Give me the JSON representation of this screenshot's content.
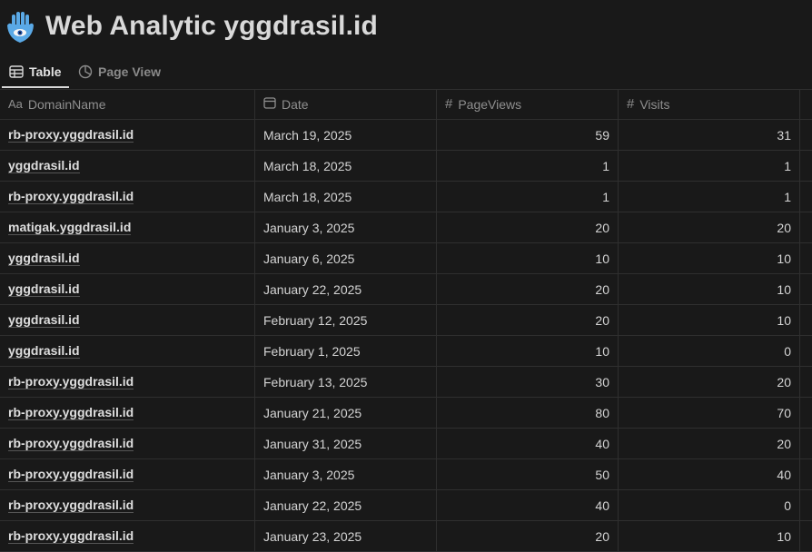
{
  "page": {
    "title": "Web Analytic yggdrasil.id",
    "icon": "hamsa-hand-icon"
  },
  "tabs": [
    {
      "label": "Table",
      "icon": "table-icon",
      "active": true
    },
    {
      "label": "Page View",
      "icon": "pie-chart-icon",
      "active": false
    }
  ],
  "table": {
    "columns": [
      {
        "label": "DomainName",
        "icon_text": "Aa"
      },
      {
        "label": "Date",
        "icon": "calendar-icon"
      },
      {
        "label": "PageViews",
        "icon_text": "#"
      },
      {
        "label": "Visits",
        "icon_text": "#"
      }
    ],
    "rows": [
      {
        "domain": "rb-proxy.yggdrasil.id",
        "date": "March 19, 2025",
        "pageviews": "59",
        "visits": "31"
      },
      {
        "domain": "yggdrasil.id",
        "date": "March 18, 2025",
        "pageviews": "1",
        "visits": "1"
      },
      {
        "domain": "rb-proxy.yggdrasil.id",
        "date": "March 18, 2025",
        "pageviews": "1",
        "visits": "1"
      },
      {
        "domain": "matigak.yggdrasil.id",
        "date": "January 3, 2025",
        "pageviews": "20",
        "visits": "20"
      },
      {
        "domain": "yggdrasil.id",
        "date": "January 6, 2025",
        "pageviews": "10",
        "visits": "10"
      },
      {
        "domain": "yggdrasil.id",
        "date": "January 22, 2025",
        "pageviews": "20",
        "visits": "10"
      },
      {
        "domain": "yggdrasil.id",
        "date": "February 12, 2025",
        "pageviews": "20",
        "visits": "10"
      },
      {
        "domain": "yggdrasil.id",
        "date": "February 1, 2025",
        "pageviews": "10",
        "visits": "0"
      },
      {
        "domain": "rb-proxy.yggdrasil.id",
        "date": "February 13, 2025",
        "pageviews": "30",
        "visits": "20"
      },
      {
        "domain": "rb-proxy.yggdrasil.id",
        "date": "January 21, 2025",
        "pageviews": "80",
        "visits": "70"
      },
      {
        "domain": "rb-proxy.yggdrasil.id",
        "date": "January 31, 2025",
        "pageviews": "40",
        "visits": "20"
      },
      {
        "domain": "rb-proxy.yggdrasil.id",
        "date": "January 3, 2025",
        "pageviews": "50",
        "visits": "40"
      },
      {
        "domain": "rb-proxy.yggdrasil.id",
        "date": "January 22, 2025",
        "pageviews": "40",
        "visits": "0"
      },
      {
        "domain": "rb-proxy.yggdrasil.id",
        "date": "January 23, 2025",
        "pageviews": "20",
        "visits": "10"
      }
    ]
  }
}
